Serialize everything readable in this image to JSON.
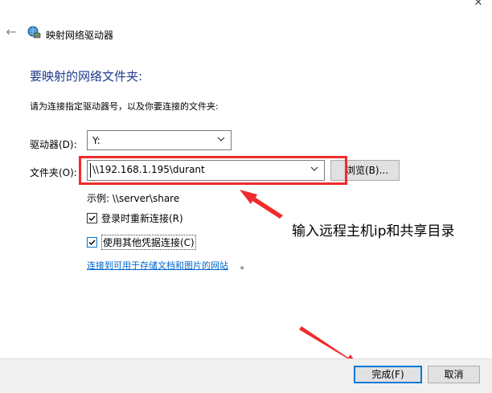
{
  "window": {
    "title": "映射网络驱动器",
    "close_glyph": "✕",
    "back_glyph": "←"
  },
  "main": {
    "heading": "要映射的网络文件夹:",
    "instruction": "请为连接指定驱动器号，以及你要连接的文件夹:",
    "drive_label": "驱动器(D):",
    "drive_value": "Y:",
    "folder_label": "文件夹(O):",
    "folder_value": "\\\\192.168.1.195\\durant",
    "browse_label": "浏览(B)...",
    "example": "示例: \\\\server\\share",
    "reconnect_label": "登录时重新连接(R)",
    "reconnect_checked": true,
    "credentials_label": "使用其他凭据连接(C)",
    "credentials_checked": true,
    "link_text": "连接到可用于存储文档和图片的网站",
    "link_suffix": "。"
  },
  "annotation": {
    "text": "输入远程主机ip和共享目录",
    "color": "#ef2b2b"
  },
  "footer": {
    "finish_label": "完成(F)",
    "cancel_label": "取消"
  },
  "colors": {
    "heading": "#1e3a8a",
    "link": "#0066cc",
    "focus": "#0078d7"
  }
}
